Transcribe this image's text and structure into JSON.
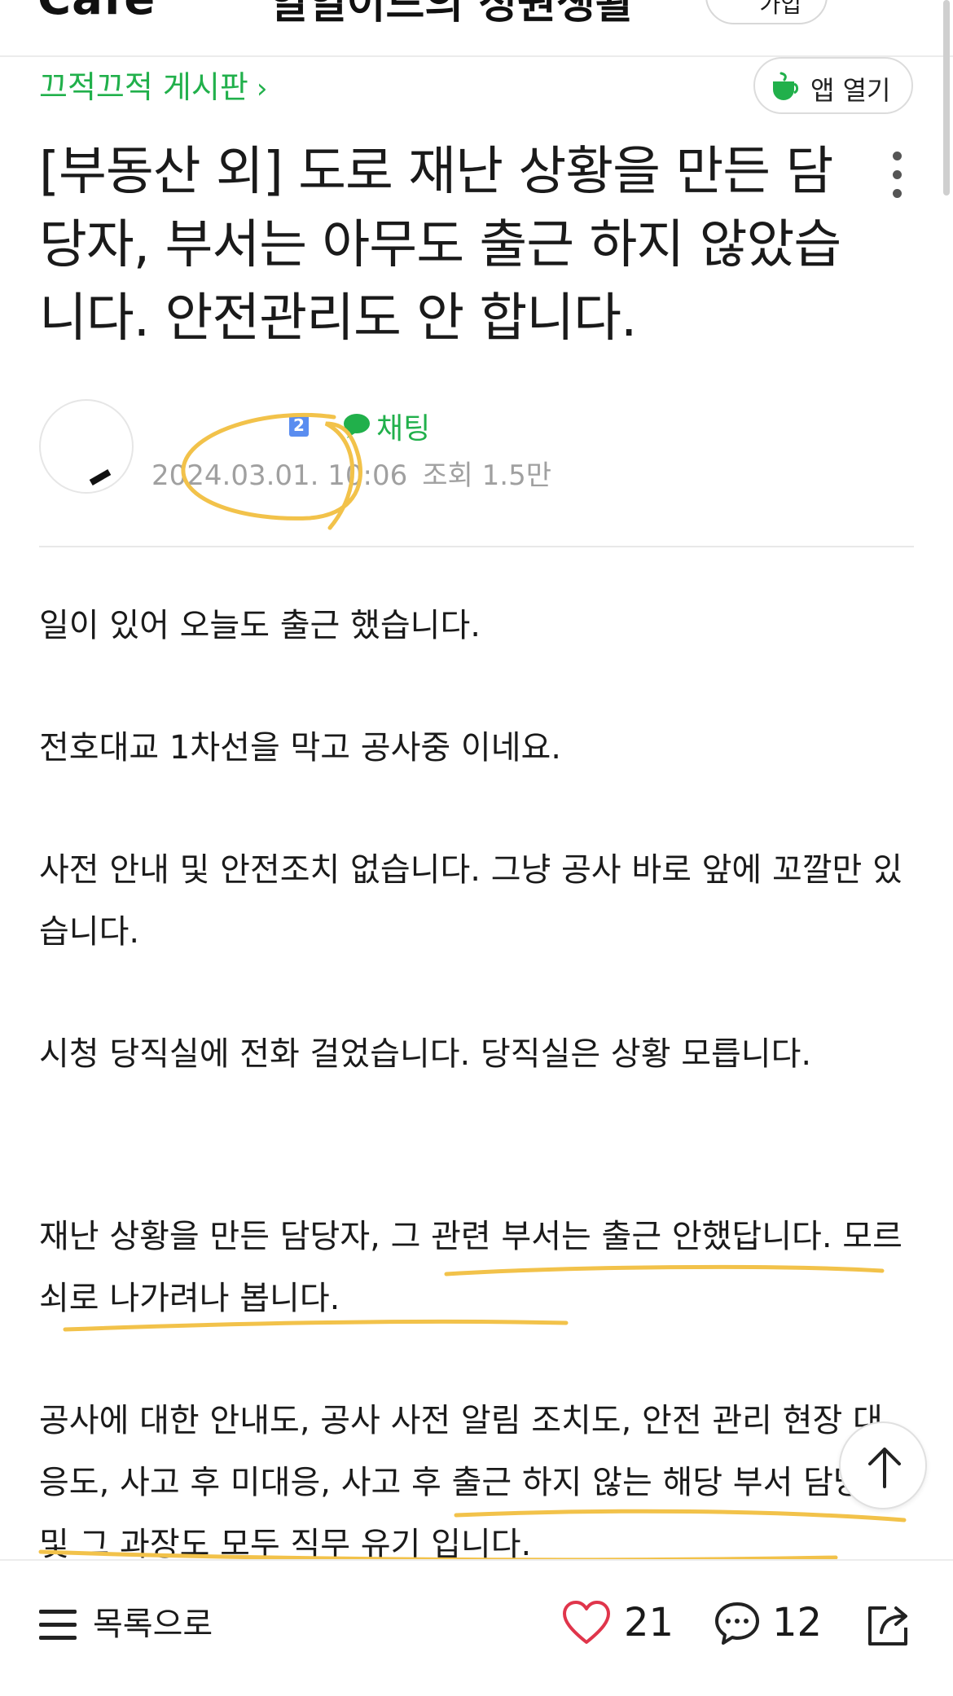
{
  "header": {
    "logo": "Cafe",
    "title": "일일이드의 정원생활",
    "action_label": "가입"
  },
  "board": {
    "name": "끄적끄적 게시판",
    "chevron": "›"
  },
  "app_open": {
    "label": "앱 열기",
    "icon": "coffee-cup-icon"
  },
  "post": {
    "title": "[부동산 외] 도로 재난 상황을 만든 담당자, 부서는 아무도 출근 하지 않았습니다. 안전관리도 안 합니다.",
    "author": {
      "level_badge": "2",
      "chat_label": "채팅"
    },
    "date": "2024.03.01. 10:06",
    "views": "조회 1.5만",
    "paragraphs": [
      "일이 있어 오늘도 출근 했습니다.",
      "전호대교 1차선을 막고 공사중 이네요.",
      "사전 안내 및 안전조치 없습니다. 그냥 공사 바로 앞에 꼬깔만 있습니다.",
      "시청 당직실에 전화 걸었습니다. 당직실은 상황 모릅니다.",
      "재난 상황을 만든 담당자, 그 관련 부서는 출근 안했답니다. 모르쇠로 나가려나 봅니다.",
      "공사에 대한 안내도, 공사 사전 알림 조치도, 안전 관리 현장 대응도, 사고 후 미대응, 사고 후 출근 하지 않는 해당 부서 담당자 및 그 과장도 모두 직무 유기 입니다."
    ]
  },
  "bottom_bar": {
    "list_label": "목록으로",
    "likes": "21",
    "comments": "12"
  },
  "colors": {
    "accent_green": "#21b04b",
    "highlight_yellow": "#f2c24a",
    "heart_red": "#e0354b"
  }
}
